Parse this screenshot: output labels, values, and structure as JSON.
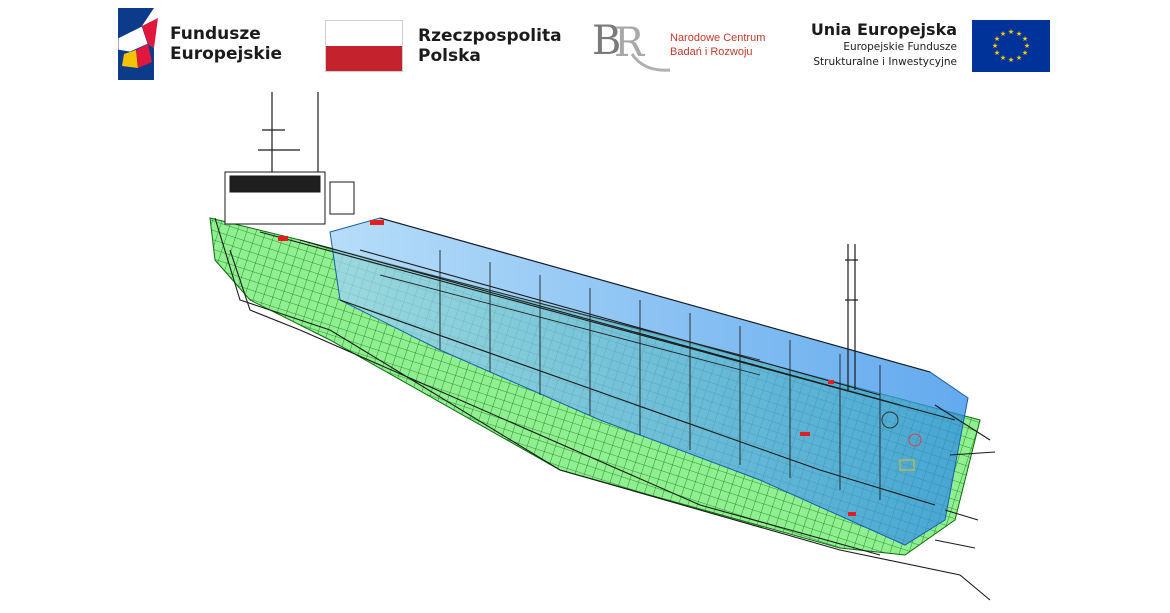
{
  "logos": {
    "fundusze": {
      "line1": "Fundusze",
      "line2": "Europejskie"
    },
    "rzeczpospolita": {
      "line1": "Rzeczpospolita",
      "line2": "Polska"
    },
    "ncbr": {
      "line1": "Narodowe Centrum",
      "line2": "Badań i Rozwoju"
    },
    "unia": {
      "title": "Unia Europejska",
      "line1": "Europejskie Fundusze",
      "line2": "Strukturalne i Inwestycyjne"
    }
  },
  "colors": {
    "hull_green": "#2fd82f",
    "cargo_blue": "#4aa8f0",
    "poland_red": "#c4232e",
    "eu_blue": "#003399",
    "eu_star": "#ffcc00",
    "ncbr_red": "#c0392b"
  },
  "illustration": {
    "icon": "ship-hull-wireframe"
  }
}
